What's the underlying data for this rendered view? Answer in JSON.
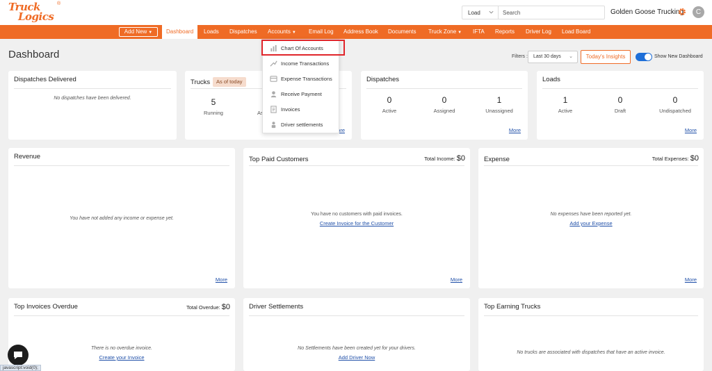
{
  "header": {
    "logo_top": "Truck",
    "logo_bottom": "Logics",
    "logo_reg": "®",
    "search_type": "Load",
    "search_placeholder": "Search",
    "company_name": "Golden Goose Trucking",
    "avatar_initial": "C"
  },
  "nav": {
    "add_new": "Add New",
    "items": [
      "Dashboard",
      "Loads",
      "Dispatches",
      "Accounts",
      "Email Log",
      "Address Book",
      "Documents",
      "Truck Zone",
      "IFTA",
      "Reports",
      "Driver Log",
      "Load Board"
    ]
  },
  "accounts_menu": {
    "items": [
      "Chart Of Accounts",
      "Income Transactions",
      "Expense Transactions",
      "Receive Payment",
      "Invoices",
      "Driver settlements"
    ],
    "highlighted": "Chart Of Accounts"
  },
  "page": {
    "title": "Dashboard",
    "filters_label": "Filters :",
    "filter_value": "Last 30 days",
    "insights_button": "Today's Insights",
    "toggle_label": "Show New Dashboard",
    "toggle_on": true
  },
  "dispatches_delivered": {
    "title": "Dispatches Delivered",
    "empty": "No dispatches have been delivered."
  },
  "trucks": {
    "title": "Trucks",
    "badge": "As of today",
    "running_value": "5",
    "running_label": "Running",
    "partial_label": "As",
    "more": "More"
  },
  "dispatches": {
    "title": "Dispatches",
    "stats": [
      {
        "value": "0",
        "label": "Active"
      },
      {
        "value": "0",
        "label": "Assigned"
      },
      {
        "value": "1",
        "label": "Unassigned"
      }
    ],
    "more": "More"
  },
  "loads": {
    "title": "Loads",
    "stats": [
      {
        "value": "1",
        "label": "Active"
      },
      {
        "value": "0",
        "label": "Draft"
      },
      {
        "value": "0",
        "label": "Undispatched"
      }
    ],
    "more": "More"
  },
  "revenue": {
    "title": "Revenue",
    "empty": "You have not added any income or expense yet.",
    "more": "More"
  },
  "top_paid": {
    "title": "Top Paid Customers",
    "total_label": "Total Income:",
    "total_value": "$0",
    "empty": "You have no customers with paid invoices.",
    "link": "Create Invoice for the Customer",
    "more": "More"
  },
  "expense": {
    "title": "Expense",
    "total_label": "Total Expenses:",
    "total_value": "$0",
    "empty": "No expenses have been reported yet.",
    "link": "Add your Expense",
    "more": "More"
  },
  "overdue": {
    "title": "Top Invoices Overdue",
    "total_label": "Total Overdue:",
    "total_value": "$0",
    "empty": "There is no overdue invoice.",
    "link": "Create your Invoice"
  },
  "settlements": {
    "title": "Driver Settlements",
    "empty": "No Settlements have been created yet for your drivers.",
    "link": "Add Driver Now"
  },
  "earning_trucks": {
    "title": "Top Earning Trucks",
    "empty": "No trucks are associated with dispatches that have an active invoice."
  },
  "status_bar": "javascript:void(0);",
  "colors": {
    "brand": "#ef6b25",
    "link": "#1f4fa8",
    "highlight": "#e0242a",
    "toggle": "#1f6fd8"
  }
}
